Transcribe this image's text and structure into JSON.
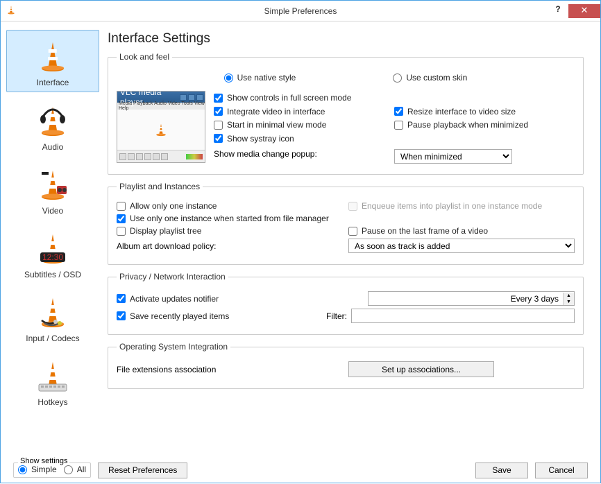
{
  "window": {
    "title": "Simple Preferences"
  },
  "sidebar": {
    "items": [
      {
        "label": "Interface"
      },
      {
        "label": "Audio"
      },
      {
        "label": "Video"
      },
      {
        "label": "Subtitles / OSD"
      },
      {
        "label": "Input / Codecs"
      },
      {
        "label": "Hotkeys"
      }
    ]
  },
  "page": {
    "title": "Interface Settings"
  },
  "groups": {
    "look": {
      "legend": "Look and feel",
      "native": "Use native style",
      "custom": "Use custom skin",
      "chk_fullscreen": "Show controls in full screen mode",
      "chk_integrate": "Integrate video in interface",
      "chk_resize": "Resize interface to video size",
      "chk_minimal": "Start in minimal view mode",
      "chk_pause_min": "Pause playback when minimized",
      "chk_systray": "Show systray icon",
      "media_popup_label": "Show media change popup:",
      "media_popup_value": "When minimized",
      "preview_title": "VLC media player",
      "preview_menus": "Media  Playback  Audio  Video  Tools  View  Help"
    },
    "playlist": {
      "legend": "Playlist and Instances",
      "chk_one": "Allow only one instance",
      "chk_enqueue": "Enqueue items into playlist in one instance mode",
      "chk_filemgr": "Use only one instance when started from file manager",
      "chk_tree": "Display playlist tree",
      "chk_lastframe": "Pause on the last frame of a video",
      "album_label": "Album art download policy:",
      "album_value": "As soon as track is added"
    },
    "privacy": {
      "legend": "Privacy / Network Interaction",
      "chk_updates": "Activate updates notifier",
      "updates_value": "Every 3 days",
      "chk_recent": "Save recently played items",
      "filter_label": "Filter:"
    },
    "os": {
      "legend": "Operating System Integration",
      "assoc_label": "File extensions association",
      "assoc_button": "Set up associations..."
    }
  },
  "footer": {
    "show_settings": "Show settings",
    "simple": "Simple",
    "all": "All",
    "reset": "Reset Preferences",
    "save": "Save",
    "cancel": "Cancel"
  }
}
